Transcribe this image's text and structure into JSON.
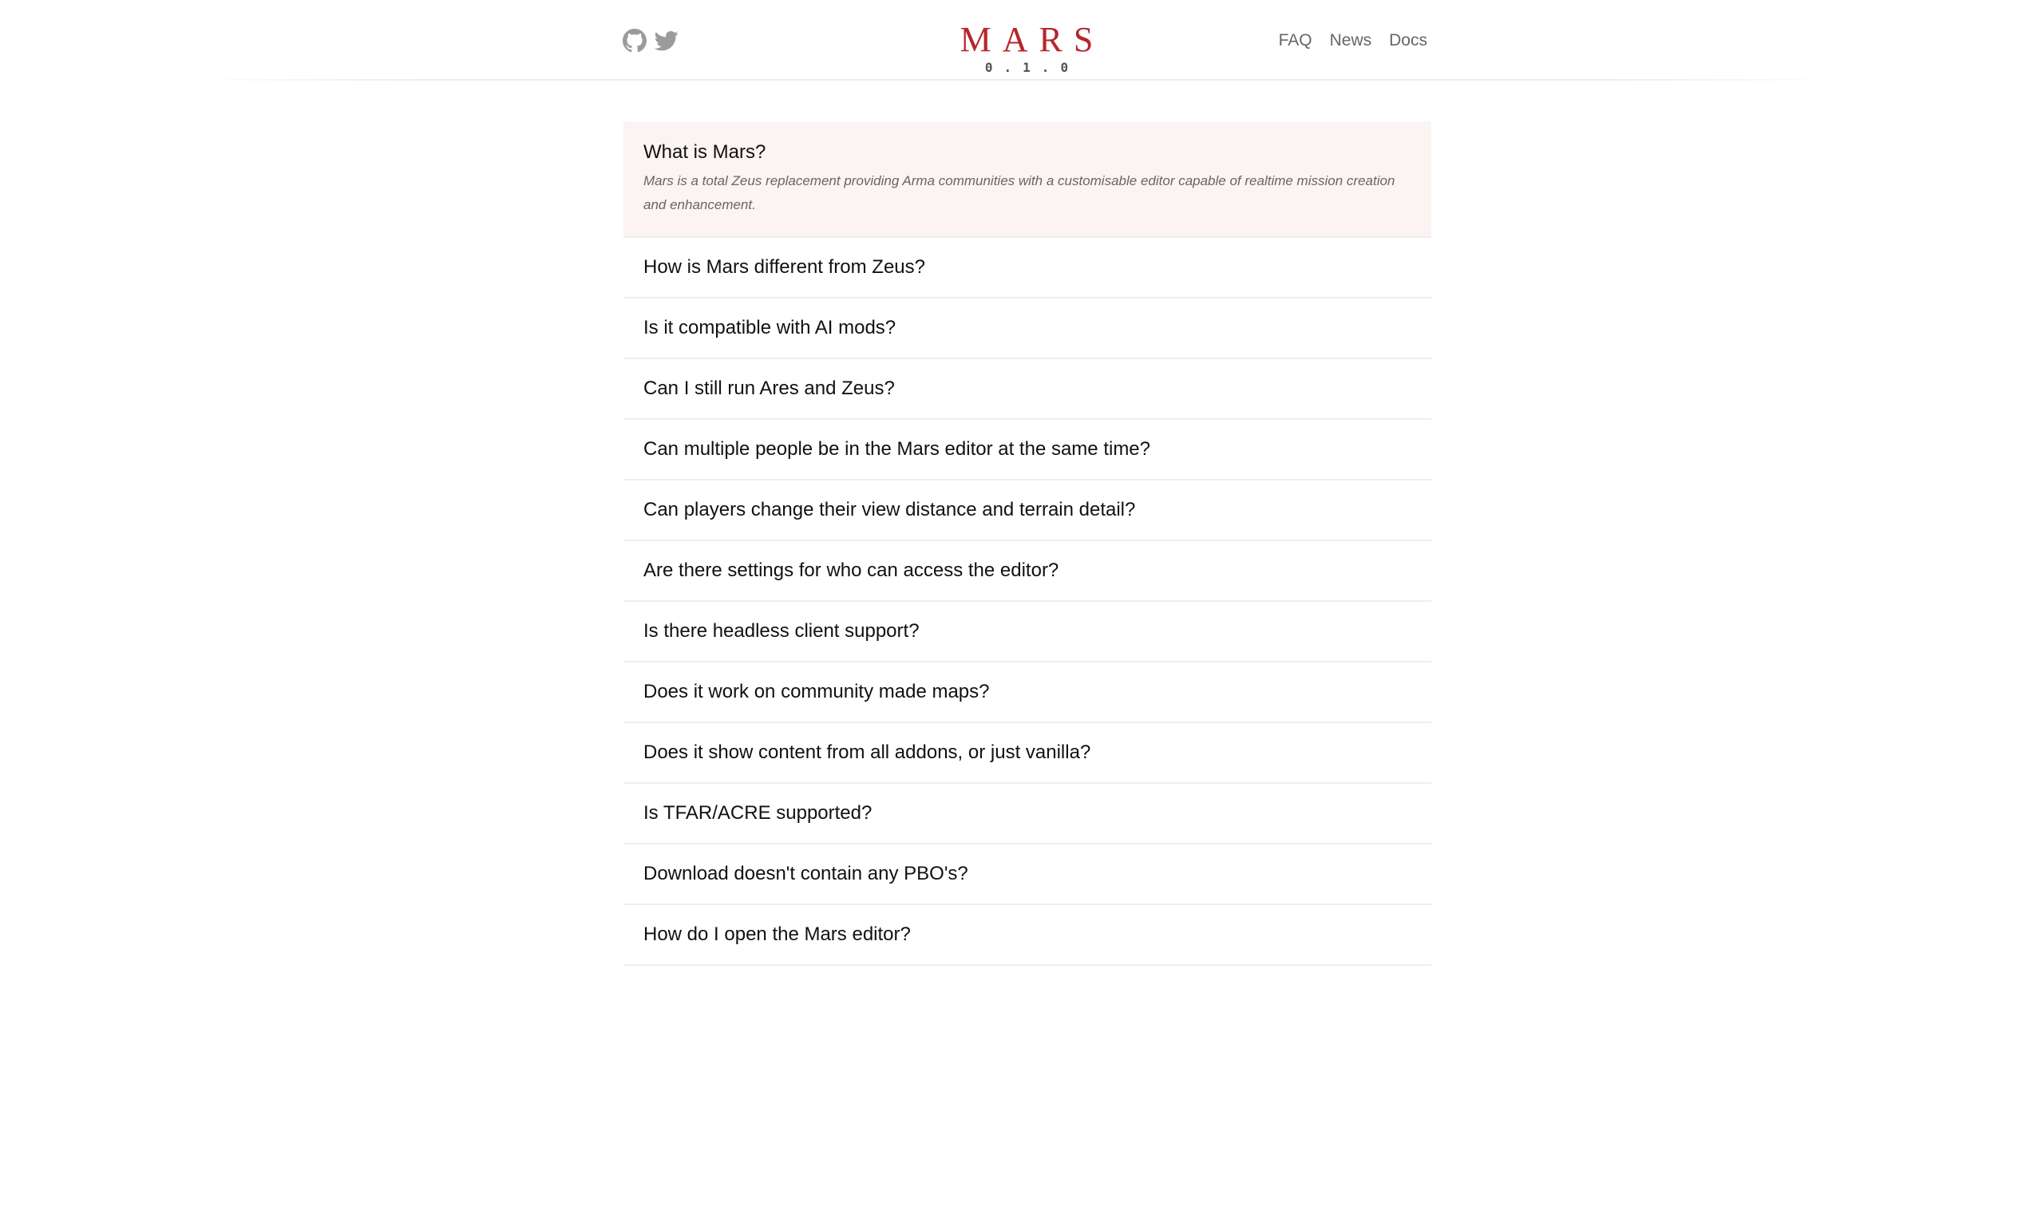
{
  "header": {
    "social": [
      {
        "icon": "github-icon",
        "label": "GitHub"
      },
      {
        "icon": "twitter-icon",
        "label": "Twitter"
      }
    ],
    "logo_title": "MARS",
    "logo_version": "0.1.0",
    "nav": [
      "FAQ",
      "News",
      "Docs"
    ],
    "colors": {
      "brand": "#b5262c",
      "icon": "#9b9b9b",
      "open_item_bg": "#fcf3f3"
    }
  },
  "faq": {
    "open_item": {
      "question": "What is Mars?",
      "answer": "Mars is a total Zeus replacement providing Arma communities with a customisable editor capable of realtime mission creation and enhancement."
    },
    "items": [
      "How is Mars different from Zeus?",
      "Is it compatible with AI mods?",
      "Can I still run Ares and Zeus?",
      "Can multiple people be in the Mars editor at the same time?",
      "Can players change their view distance and terrain detail?",
      "Are there settings for who can access the editor?",
      "Is there headless client support?",
      "Does it work on community made maps?",
      "Does it show content from all addons, or just vanilla?",
      "Is TFAR/ACRE supported?",
      "Download doesn't contain any PBO's?",
      "How do I open the Mars editor?"
    ]
  }
}
